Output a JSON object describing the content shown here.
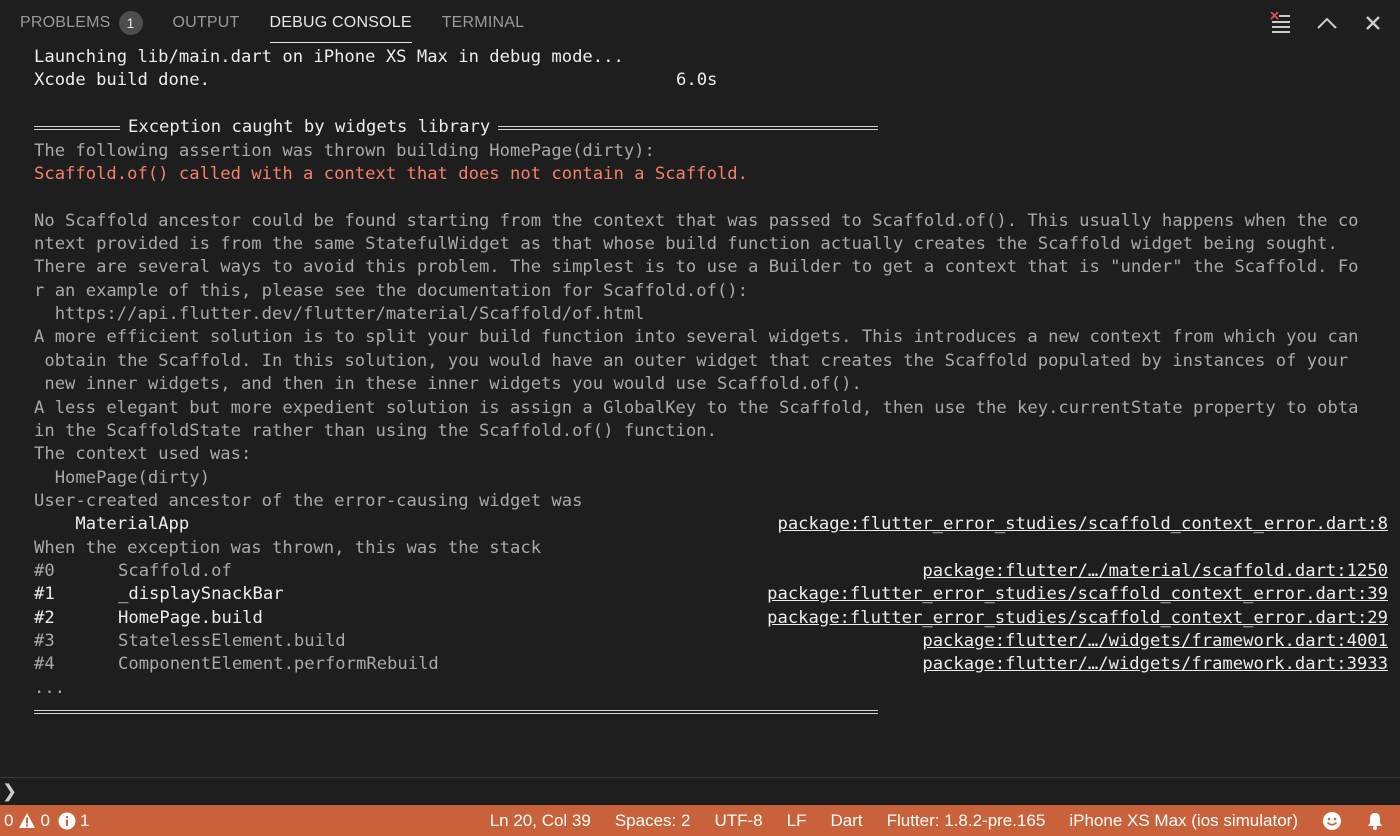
{
  "tabs": [
    {
      "label": "PROBLEMS",
      "badge": "1"
    },
    {
      "label": "OUTPUT"
    },
    {
      "label": "DEBUG CONSOLE"
    },
    {
      "label": "TERMINAL"
    }
  ],
  "console": {
    "launch": "Launching lib/main.dart on iPhone XS Max in debug mode...",
    "build": "Xcode build done.",
    "build_time": "6.0s",
    "exception_title": "Exception caught by widgets library",
    "assertion": "The following assertion was thrown building HomePage(dirty):",
    "error": "Scaffold.of() called with a context that does not contain a Scaffold.",
    "msg1": "No Scaffold ancestor could be found starting from the context that was passed to Scaffold.of(). This usually happens when the co",
    "msg2": "ntext provided is from the same StatefulWidget as that whose build function actually creates the Scaffold widget being sought.",
    "msg3": "There are several ways to avoid this problem. The simplest is to use a Builder to get a context that is \"under\" the Scaffold. Fo",
    "msg4": "r an example of this, please see the documentation for Scaffold.of():",
    "msg5": "  https://api.flutter.dev/flutter/material/Scaffold/of.html",
    "msg6": "A more efficient solution is to split your build function into several widgets. This introduces a new context from which you can",
    "msg7": " obtain the Scaffold. In this solution, you would have an outer widget that creates the Scaffold populated by instances of your",
    "msg8": " new inner widgets, and then in these inner widgets you would use Scaffold.of().",
    "msg9": "A less elegant but more expedient solution is assign a GlobalKey to the Scaffold, then use the key.currentState property to obta",
    "msg10": "in the ScaffoldState rather than using the Scaffold.of() function.",
    "ctx_label": "The context used was:",
    "ctx_value": "  HomePage(dirty)",
    "ancestor_label": "User-created ancestor of the error-causing widget was",
    "ancestor_value": "    MaterialApp",
    "ancestor_link": "package:flutter_error_studies/scaffold_context_error.dart:8",
    "stack_label": "When the exception was thrown, this was the stack",
    "stack": [
      {
        "num": "#0",
        "fn": "Scaffold.of",
        "link": "package:flutter/…/material/scaffold.dart:1250"
      },
      {
        "num": "#1",
        "fn": "_displaySnackBar",
        "link": "package:flutter_error_studies/scaffold_context_error.dart:39"
      },
      {
        "num": "#2",
        "fn": "HomePage.build",
        "link": "package:flutter_error_studies/scaffold_context_error.dart:29"
      },
      {
        "num": "#3",
        "fn": "StatelessElement.build",
        "link": "package:flutter/…/widgets/framework.dart:4001"
      },
      {
        "num": "#4",
        "fn": "ComponentElement.performRebuild",
        "link": "package:flutter/…/widgets/framework.dart:3933"
      }
    ],
    "ellipsis": "..."
  },
  "input": {
    "prompt": "❯",
    "value": ""
  },
  "status": {
    "errors": "0",
    "warnings": "0",
    "infos": "1",
    "position": "Ln 20, Col 39",
    "spaces": "Spaces: 2",
    "encoding": "UTF-8",
    "eol": "LF",
    "language": "Dart",
    "flutter": "Flutter: 1.8.2-pre.165",
    "device": "iPhone XS Max (ios simulator)"
  },
  "colors": {
    "background": "#1e1e1e",
    "error_text": "#f3816a",
    "statusbar": "#c9623a"
  }
}
